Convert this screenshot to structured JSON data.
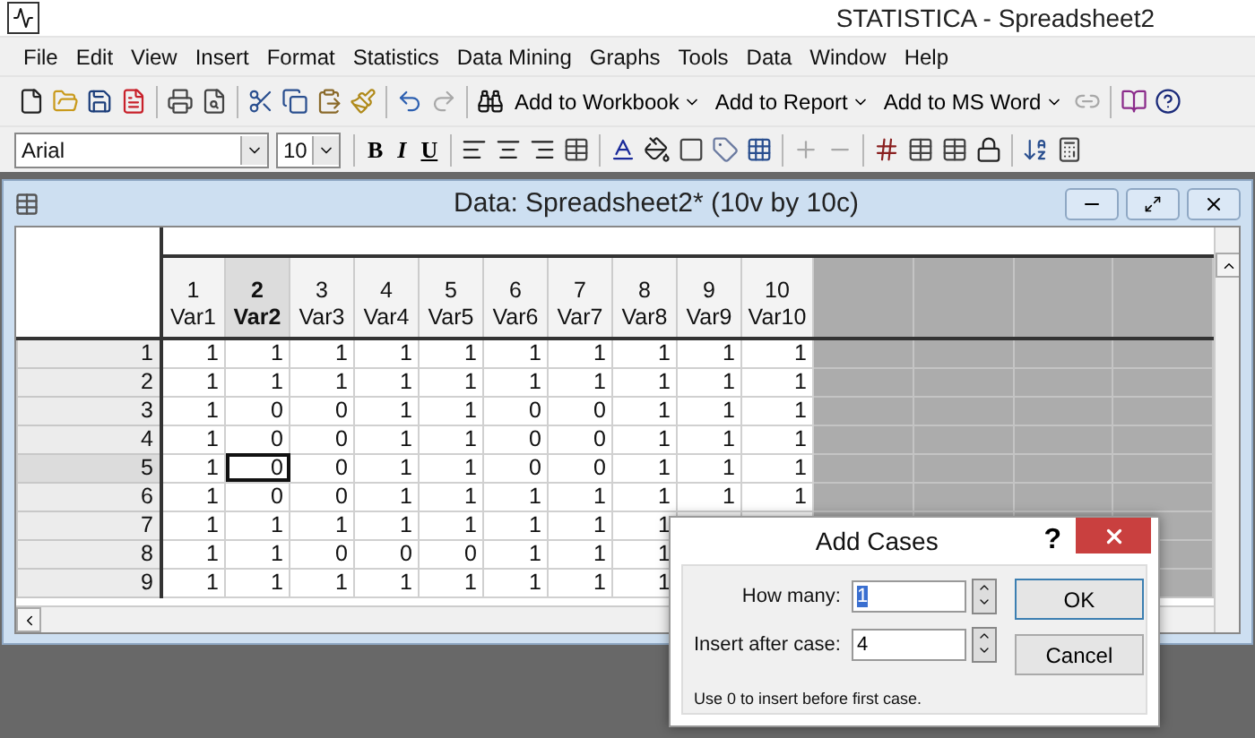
{
  "window": {
    "title": "STATISTICA - Spreadsheet2"
  },
  "menu": [
    "File",
    "Edit",
    "View",
    "Insert",
    "Format",
    "Statistics",
    "Data Mining",
    "Graphs",
    "Tools",
    "Data",
    "Window",
    "Help"
  ],
  "toolbar": [
    {
      "kind": "icon",
      "disabled": false
    },
    {
      "kind": "icon",
      "disabled": false
    },
    {
      "kind": "icon",
      "disabled": false
    },
    {
      "kind": "icon",
      "disabled": false
    },
    {
      "kind": "sep"
    },
    {
      "kind": "icon",
      "disabled": false
    },
    {
      "kind": "icon",
      "disabled": false
    },
    {
      "kind": "sep"
    },
    {
      "kind": "icon",
      "disabled": false
    },
    {
      "kind": "icon",
      "disabled": false
    },
    {
      "kind": "icon",
      "disabled": false
    },
    {
      "kind": "icon",
      "disabled": false
    },
    {
      "kind": "sep"
    },
    {
      "kind": "icon",
      "disabled": false
    },
    {
      "kind": "icon",
      "disabled": true
    },
    {
      "kind": "sep"
    },
    {
      "kind": "icon",
      "disabled": false
    },
    {
      "kind": "menu",
      "label": "Add to Workbook"
    },
    {
      "kind": "menu",
      "label": "Add to Report"
    },
    {
      "kind": "menu",
      "label": "Add to MS Word"
    },
    {
      "kind": "icon",
      "disabled": true
    },
    {
      "kind": "sep"
    },
    {
      "kind": "icon",
      "disabled": false
    },
    {
      "kind": "icon",
      "disabled": false
    }
  ],
  "format_bar": {
    "font": "Arial",
    "size": "10",
    "styles": [
      "B",
      "I",
      "U"
    ],
    "tools": [
      {
        "kind": "sep"
      },
      {
        "kind": "icon",
        "disabled": false
      },
      {
        "kind": "icon",
        "disabled": false
      },
      {
        "kind": "icon",
        "disabled": false
      },
      {
        "kind": "icon",
        "disabled": false
      },
      {
        "kind": "sep"
      },
      {
        "kind": "icon",
        "disabled": false
      },
      {
        "kind": "icon",
        "disabled": false
      },
      {
        "kind": "icon",
        "disabled": false
      },
      {
        "kind": "icon",
        "disabled": false
      },
      {
        "kind": "icon",
        "disabled": false
      },
      {
        "kind": "sep"
      },
      {
        "kind": "icon",
        "disabled": true
      },
      {
        "kind": "icon",
        "disabled": true
      },
      {
        "kind": "sep"
      },
      {
        "kind": "icon",
        "disabled": false
      },
      {
        "kind": "icon",
        "disabled": false
      },
      {
        "kind": "icon",
        "disabled": false
      },
      {
        "kind": "icon",
        "disabled": false
      },
      {
        "kind": "sep"
      },
      {
        "kind": "icon",
        "disabled": false
      },
      {
        "kind": "icon",
        "disabled": false
      }
    ]
  },
  "spreadsheet": {
    "title": "Data: Spreadsheet2* (10v by 10c)",
    "columns": [
      {
        "number": "1",
        "name": "Var1",
        "selected": false
      },
      {
        "number": "2",
        "name": "Var2",
        "selected": true
      },
      {
        "number": "3",
        "name": "Var3",
        "selected": false
      },
      {
        "number": "4",
        "name": "Var4",
        "selected": false
      },
      {
        "number": "5",
        "name": "Var5",
        "selected": false
      },
      {
        "number": "6",
        "name": "Var6",
        "selected": false
      },
      {
        "number": "7",
        "name": "Var7",
        "selected": false
      },
      {
        "number": "8",
        "name": "Var8",
        "selected": false
      },
      {
        "number": "9",
        "name": "Var9",
        "selected": false
      },
      {
        "number": "10",
        "name": "Var10",
        "selected": false
      }
    ],
    "rows": [
      {
        "label": "1",
        "selected": false,
        "values": [
          "1",
          "1",
          "1",
          "1",
          "1",
          "1",
          "1",
          "1",
          "1",
          "1"
        ]
      },
      {
        "label": "2",
        "selected": false,
        "values": [
          "1",
          "1",
          "1",
          "1",
          "1",
          "1",
          "1",
          "1",
          "1",
          "1"
        ]
      },
      {
        "label": "3",
        "selected": false,
        "values": [
          "1",
          "0",
          "0",
          "1",
          "1",
          "0",
          "0",
          "1",
          "1",
          "1"
        ]
      },
      {
        "label": "4",
        "selected": false,
        "values": [
          "1",
          "0",
          "0",
          "1",
          "1",
          "0",
          "0",
          "1",
          "1",
          "1"
        ]
      },
      {
        "label": "5",
        "selected": true,
        "values": [
          "1",
          "0",
          "0",
          "1",
          "1",
          "0",
          "0",
          "1",
          "1",
          "1"
        ]
      },
      {
        "label": "6",
        "selected": false,
        "values": [
          "1",
          "0",
          "0",
          "1",
          "1",
          "1",
          "1",
          "1",
          "1",
          "1"
        ]
      },
      {
        "label": "7",
        "selected": false,
        "values": [
          "1",
          "1",
          "1",
          "1",
          "1",
          "1",
          "1",
          "1"
        ]
      },
      {
        "label": "8",
        "selected": false,
        "values": [
          "1",
          "1",
          "0",
          "0",
          "0",
          "1",
          "1",
          "1"
        ]
      },
      {
        "label": "9",
        "selected": false,
        "values": [
          "1",
          "1",
          "1",
          "1",
          "1",
          "1",
          "1",
          "1"
        ]
      }
    ]
  },
  "dialog": {
    "title": "Add Cases",
    "help": "?",
    "fields": [
      {
        "label": "How many:",
        "value": "1",
        "selected": true
      },
      {
        "label": "Insert after case:",
        "value": "4",
        "selected": false
      }
    ],
    "buttons": [
      "OK",
      "Cancel"
    ],
    "note": "Use 0 to insert before first case."
  }
}
